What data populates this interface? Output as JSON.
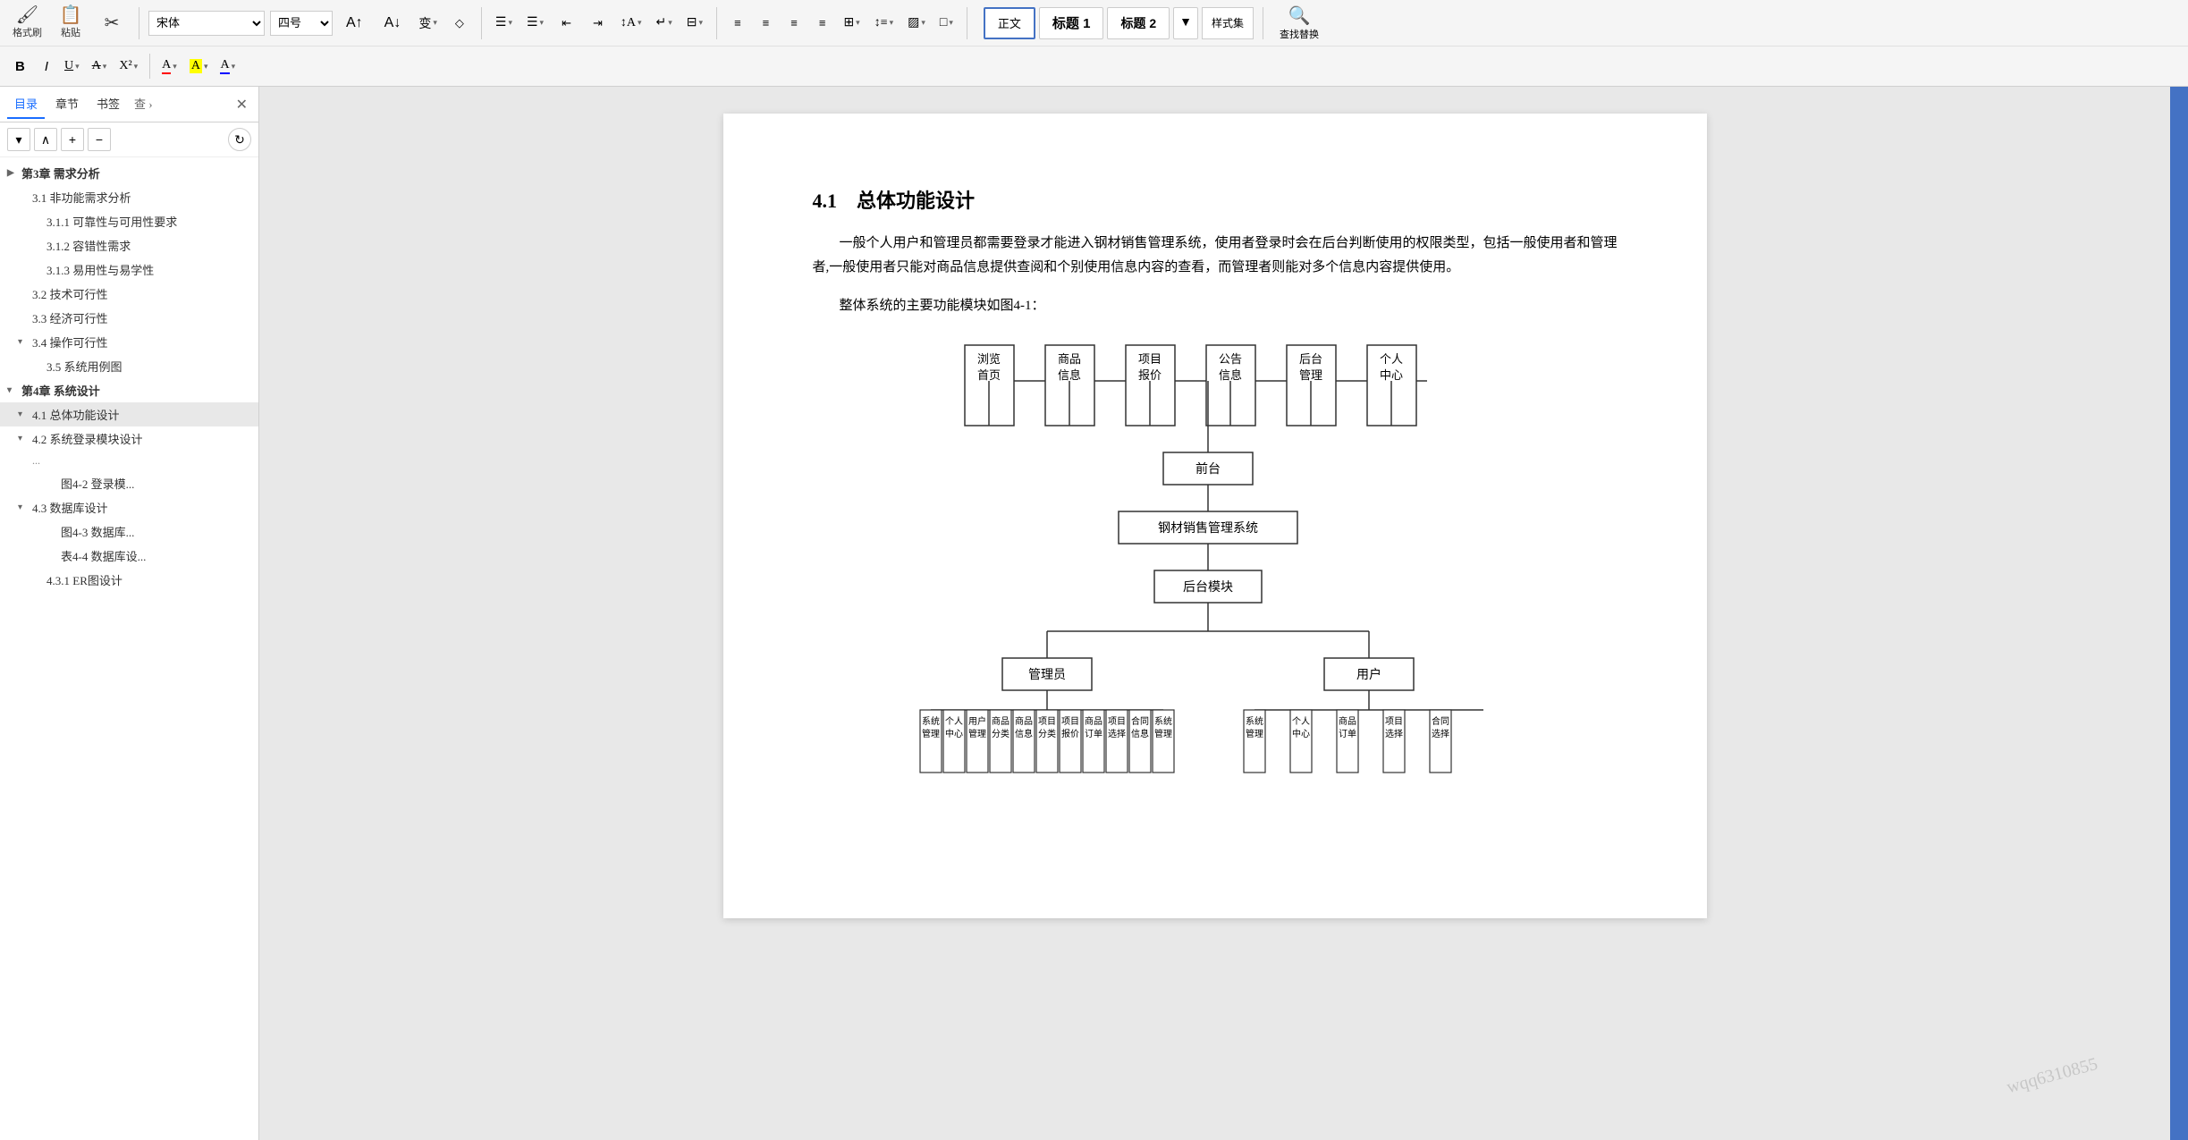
{
  "toolbar": {
    "row1": {
      "format_painter_label": "格式刷",
      "paste_label": "粘贴",
      "cut_label": "",
      "font_family": "宋体",
      "font_size": "四号",
      "increase_font": "A",
      "decrease_font": "A",
      "change_case": "变",
      "clear_format": "◇",
      "list_bullet": "≡",
      "list_number": "≡",
      "indent_decrease": "⇤",
      "indent_increase": "⇥",
      "sort": "↕",
      "show_para": "¶",
      "columns": "⊟",
      "line_spacing": "≡",
      "align_btns": [
        "≡",
        "≡",
        "≡",
        "≡",
        "≡",
        "≡"
      ],
      "styles": {
        "normal": "正文",
        "title1": "标题 1",
        "title2": "标题 2",
        "more_arrow": "▼",
        "gallery_label": "样式集"
      },
      "find_replace_label": "查找替换"
    },
    "row2": {
      "bold": "B",
      "italic": "I",
      "underline": "U",
      "strikethrough": "A",
      "super_sub": "X²",
      "font_color": "A",
      "highlight": "A",
      "text_color": "A"
    }
  },
  "left_panel": {
    "tabs": [
      "目录",
      "章节",
      "书签",
      "查 ›"
    ],
    "controls": {
      "expand_btn": "▼",
      "up_btn": "∧",
      "add_btn": "+",
      "remove_btn": "−",
      "refresh_btn": "↻"
    },
    "toc_items": [
      {
        "level": 1,
        "text": "第3章  需求分析",
        "expanded": false,
        "active": false
      },
      {
        "level": 2,
        "text": "3.1  非功能需求分析",
        "expanded": false,
        "active": false
      },
      {
        "level": 3,
        "text": "3.1.1  可靠性与可用性要求",
        "expanded": false,
        "active": false
      },
      {
        "level": 3,
        "text": "3.1.2  容错性需求",
        "expanded": false,
        "active": false
      },
      {
        "level": 3,
        "text": "3.1.3  易用性与易学性",
        "expanded": false,
        "active": false
      },
      {
        "level": 2,
        "text": "3.2  技术可行性",
        "expanded": false,
        "active": false
      },
      {
        "level": 2,
        "text": "3.3  经济可行性",
        "expanded": false,
        "active": false
      },
      {
        "level": 2,
        "text": "3.4  操作可行性",
        "expanded": true,
        "active": false
      },
      {
        "level": 3,
        "text": "3.5  系统用例图",
        "expanded": false,
        "active": false
      },
      {
        "level": 1,
        "text": "第4章   系统设计",
        "expanded": true,
        "active": false
      },
      {
        "level": 2,
        "text": "4.1   总体功能设计",
        "expanded": true,
        "active": true
      },
      {
        "level": 2,
        "text": "4.2  系统登录模块设计",
        "expanded": true,
        "active": false
      },
      {
        "level": 4,
        "text": "图4-2   登录模...",
        "expanded": false,
        "active": false
      },
      {
        "level": 2,
        "text": "4.3  数据库设计",
        "expanded": true,
        "active": false
      },
      {
        "level": 4,
        "text": "图4-3   数据库...",
        "expanded": false,
        "active": false
      },
      {
        "level": 4,
        "text": "表4-4   数据库设...",
        "expanded": false,
        "active": false
      },
      {
        "level": 3,
        "text": "4.3.1   ER图设计",
        "expanded": false,
        "active": false
      }
    ]
  },
  "content": {
    "section_number": "4.1",
    "section_title": "总体功能设计",
    "paragraph1": "一般个人用户和管理员都需要登录才能进入钢材销售管理系统，使用者登录时会在后台判断使用的权限类型，包括一般使用者和管理者,一般使用者只能对商品信息提供查阅和个别使用信息内容的查看，而管理者则能对多个信息内容提供使用。",
    "paragraph2": "整体系统的主要功能模块如图4-1：",
    "flowchart": {
      "top_boxes": [
        "浏览首页",
        "商品信息",
        "项目报价",
        "公告信息",
        "后台管理",
        "个人中心"
      ],
      "level1": "前台",
      "level2": "钢材销售管理系统",
      "level3": "后台模块",
      "left_node": "管理员",
      "right_node": "用户",
      "bottom_left_boxes": [
        "系统管\n理",
        "个人中\n心",
        "用户管\n理",
        "商品分\n类",
        "商品信\n息",
        "项目分\n类",
        "项目报\n价",
        "商品订\n单",
        "项目选\n择",
        "合同信\n息",
        "系统管\n理"
      ],
      "bottom_right_boxes": [
        "系统管\n理",
        "个人中\n心",
        "商品订\n单",
        "项目选\n择",
        "合同选\n择"
      ]
    }
  },
  "right_sidebar": {
    "tab_label": ""
  },
  "watermark": "wqq6310855"
}
